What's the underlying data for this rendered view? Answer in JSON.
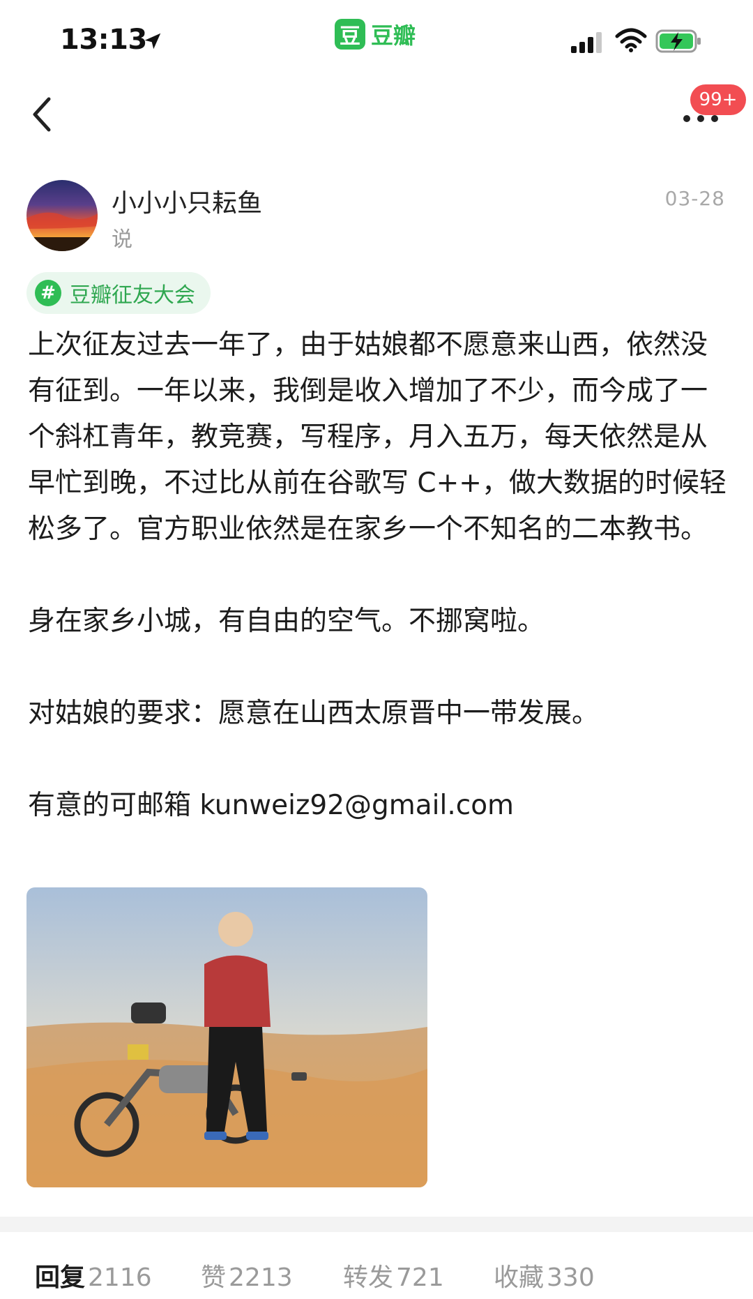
{
  "status_bar": {
    "time": "13:13",
    "app_logo_glyph": "豆",
    "app_name": "豆瓣",
    "icons": [
      "location-arrow-icon",
      "signal-icon",
      "wifi-icon",
      "battery-charging-icon"
    ]
  },
  "nav": {
    "back_icon": "chevron-left-icon",
    "more_icon": "more-dots-icon",
    "notification_badge": "99+"
  },
  "post": {
    "author": "小小小只耘鱼",
    "action": "说",
    "date": "03-28",
    "topic": {
      "hash_glyph": "#",
      "label": "豆瓣征友大会"
    },
    "paragraphs": [
      "上次征友过去一年了，由于姑娘都不愿意来山西，依然没有征到。一年以来，我倒是收入增加了不少，而今成了一个斜杠青年，教竞赛，写程序，月入五万，每天依然是从早忙到晚，不过比从前在谷歌写 C++，做大数据的时候轻松多了。官方职业依然是在家乡一个不知名的二本教书。",
      "身在家乡小城，有自由的空气。不挪窝啦。",
      "对姑娘的要求：愿意在山西太原晋中一带发展。",
      "有意的可邮箱 kunweiz92@gmail.com"
    ]
  },
  "actions": [
    {
      "label": "回复",
      "count": "2116",
      "active": true
    },
    {
      "label": "赞",
      "count": "2213",
      "active": false
    },
    {
      "label": "转发",
      "count": "721",
      "active": false
    },
    {
      "label": "收藏",
      "count": "330",
      "active": false
    }
  ],
  "colors": {
    "brand_green": "#2fbd55",
    "badge_red": "#f24d52",
    "topic_bg": "#eaf7ee",
    "muted_text": "#9a9a9a"
  }
}
